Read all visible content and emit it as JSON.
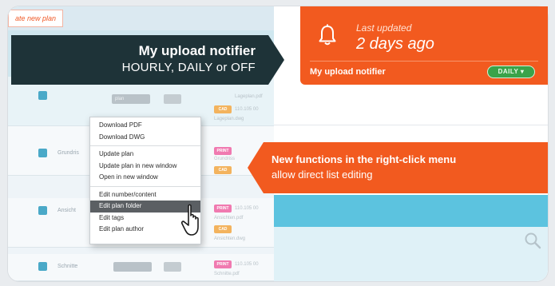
{
  "toolbar": {
    "create_label": "ate new plan"
  },
  "rows": [
    {
      "name": "",
      "box": "plan",
      "tags": [
        "CAD"
      ],
      "file1": "110.105 00",
      "file2": "Lageplan.pdf",
      "file3": "Lageplan.dwg"
    },
    {
      "name": "Grundris",
      "tags": [
        "PRINT",
        "CAD"
      ],
      "file1": "",
      "file2": "Grundriss"
    },
    {
      "name": "Ansicht",
      "tags": [
        "PRINT",
        "CAD"
      ],
      "file1": "110.105 00",
      "file2": "Ansichten.pdf",
      "file3": "Ansichten.dwg"
    },
    {
      "name": "Schnitte",
      "tags": [
        "PRINT"
      ],
      "file1": "110.105 00",
      "file2": "Schnitte.pdf"
    }
  ],
  "notifier": {
    "updated_label": "Last updated",
    "updated_value": "2 days ago",
    "name": "My upload notifier",
    "frequency": "DAILY ▾"
  },
  "callout_dark": {
    "title": "My upload notifier",
    "subtitle": "HOURLY, DAILY or OFF"
  },
  "callout_orange": {
    "title": "New functions in the right-click menu",
    "subtitle": "allow direct list editing"
  },
  "context_menu": {
    "groups": [
      [
        "Download PDF",
        "Download DWG"
      ],
      [
        "Update plan",
        "Update plan in new window",
        "Open in new window"
      ],
      [
        "Edit number/content",
        "Edit plan folder",
        "Edit tags",
        "Edit plan author"
      ]
    ],
    "highlighted": "Edit plan folder"
  },
  "colors": {
    "accent_orange": "#f25a1f",
    "dark_callout": "#1e3338",
    "daily_green": "#3aa34a",
    "cyan": "#5cc3df"
  },
  "icons": [
    "bell-icon",
    "search-icon",
    "cursor-icon",
    "chevron-down-icon"
  ]
}
